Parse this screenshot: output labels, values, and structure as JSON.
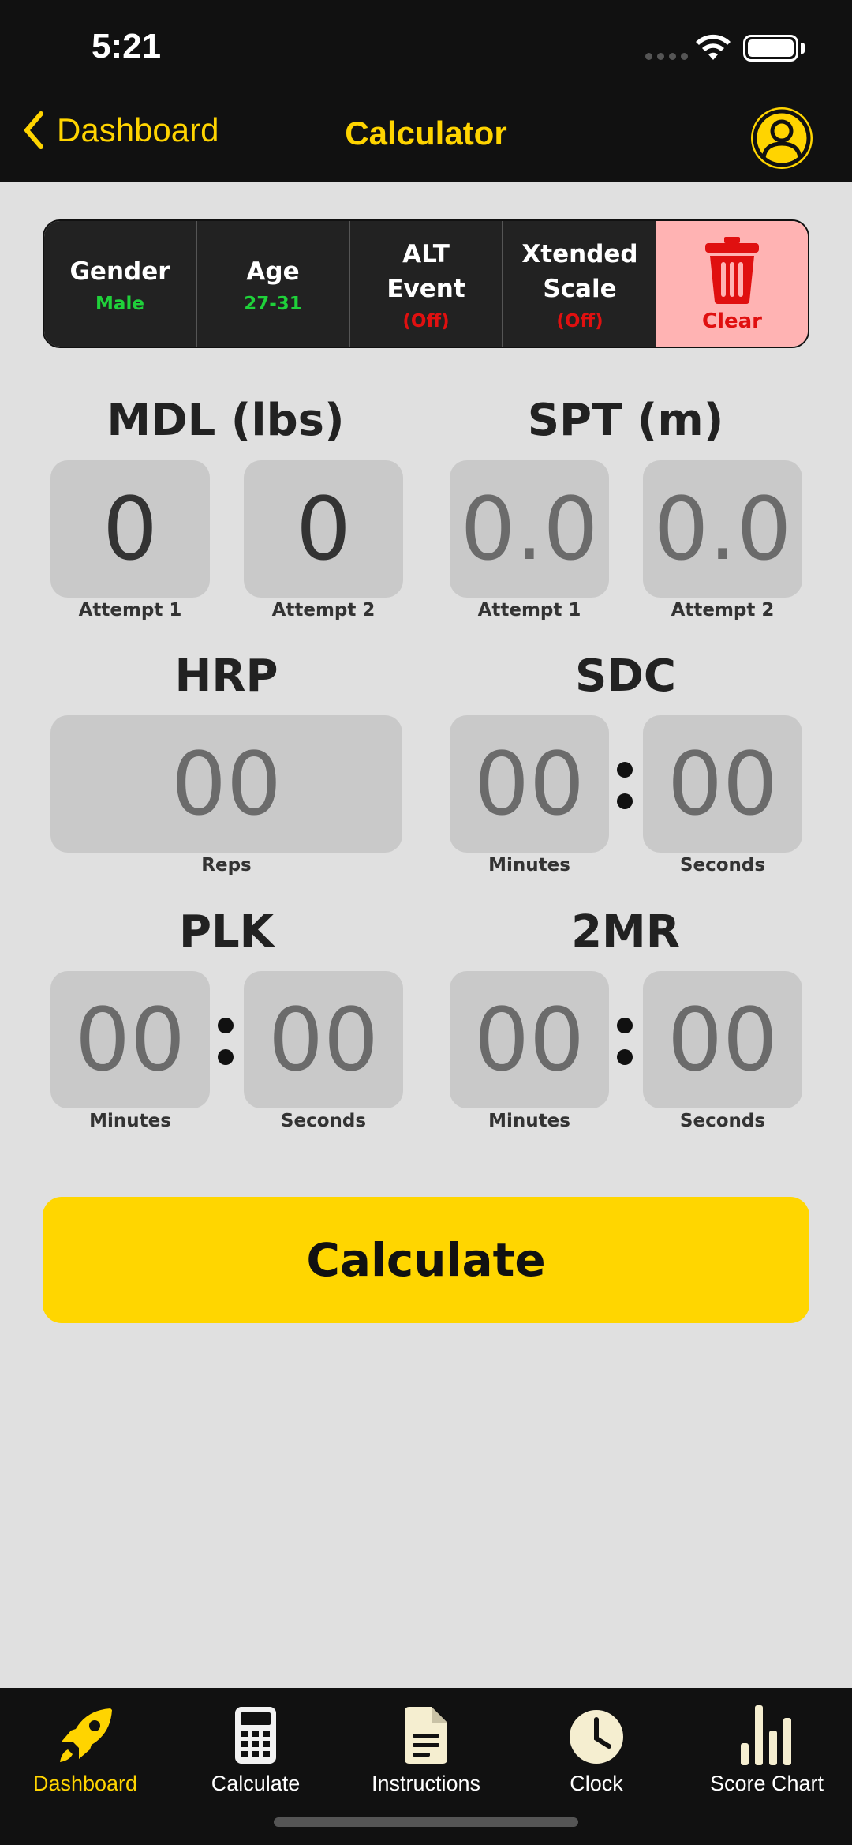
{
  "status_bar": {
    "time": "5:21"
  },
  "nav": {
    "back_label": "Dashboard",
    "title": "Calculator"
  },
  "settings": [
    {
      "label": "Gender",
      "value": "Male",
      "value_color": "#1fd13a"
    },
    {
      "label": "Age",
      "value": "27-31",
      "value_color": "#1fd13a"
    },
    {
      "label": "ALT Event",
      "value": "(Off)",
      "value_color": "#e01010"
    },
    {
      "label": "Xtended Scale",
      "value": "(Off)",
      "value_color": "#e01010"
    }
  ],
  "clear_label": "Clear",
  "events": {
    "mdl": {
      "title": "MDL (lbs)",
      "attempt1": "0",
      "attempt2": "0",
      "cap1": "Attempt 1",
      "cap2": "Attempt 2"
    },
    "spt": {
      "title": "SPT (m)",
      "attempt1": "0.0",
      "attempt2": "0.0",
      "cap1": "Attempt 1",
      "cap2": "Attempt 2"
    },
    "hrp": {
      "title": "HRP",
      "reps": "00",
      "cap": "Reps"
    },
    "sdc": {
      "title": "SDC",
      "minutes": "00",
      "seconds": "00",
      "cap_min": "Minutes",
      "cap_sec": "Seconds"
    },
    "plk": {
      "title": "PLK",
      "minutes": "00",
      "seconds": "00",
      "cap_min": "Minutes",
      "cap_sec": "Seconds"
    },
    "tmr": {
      "title": "2MR",
      "minutes": "00",
      "seconds": "00",
      "cap_min": "Minutes",
      "cap_sec": "Seconds"
    }
  },
  "calculate_label": "Calculate",
  "tabs": [
    {
      "label": "Dashboard",
      "icon": "rocket-icon",
      "active": true
    },
    {
      "label": "Calculate",
      "icon": "calculator-icon",
      "active": false
    },
    {
      "label": "Instructions",
      "icon": "document-icon",
      "active": false
    },
    {
      "label": "Clock",
      "icon": "clock-icon",
      "active": false
    },
    {
      "label": "Score Chart",
      "icon": "bar-chart-icon",
      "active": false
    }
  ],
  "colors": {
    "accent": "#ffd400",
    "background": "#e0e0e0",
    "bar": "#111111",
    "green": "#1fd13a",
    "red": "#e01010"
  }
}
